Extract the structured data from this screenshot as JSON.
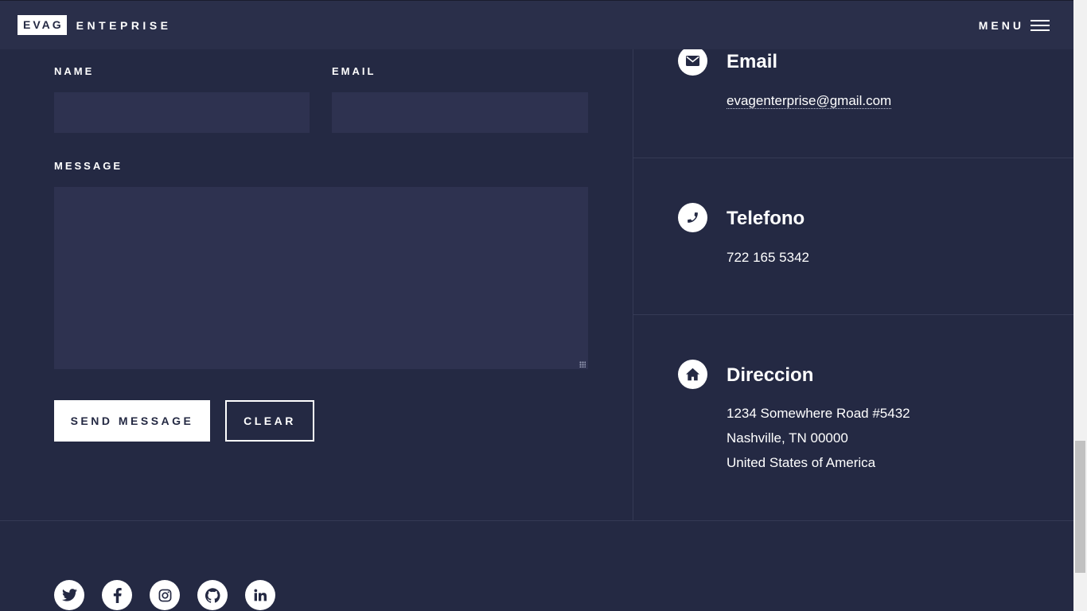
{
  "header": {
    "logo_box": "EVAG",
    "logo_text": "ENTEPRISE",
    "menu_label": "MENU"
  },
  "form": {
    "name_label": "NAME",
    "name_value": "",
    "email_label": "EMAIL",
    "email_value": "",
    "message_label": "MESSAGE",
    "message_value": "",
    "send_label": "SEND MESSAGE",
    "clear_label": "CLEAR"
  },
  "contact": {
    "email": {
      "icon": "envelope-icon",
      "title": "Email",
      "value": "evagenterprise@gmail.com"
    },
    "phone": {
      "icon": "phone-icon",
      "title": "Telefono",
      "value": "722 165 5342"
    },
    "address": {
      "icon": "home-icon",
      "title": "Direccion",
      "lines": [
        "1234 Somewhere Road #5432",
        "Nashville, TN 00000",
        "United States of America"
      ]
    }
  },
  "social": [
    "twitter-icon",
    "facebook-icon",
    "instagram-icon",
    "github-icon",
    "linkedin-icon"
  ],
  "colors": {
    "background": "#242943",
    "header": "#2a2f4a",
    "field": "#2e3250",
    "text": "#ffffff"
  }
}
